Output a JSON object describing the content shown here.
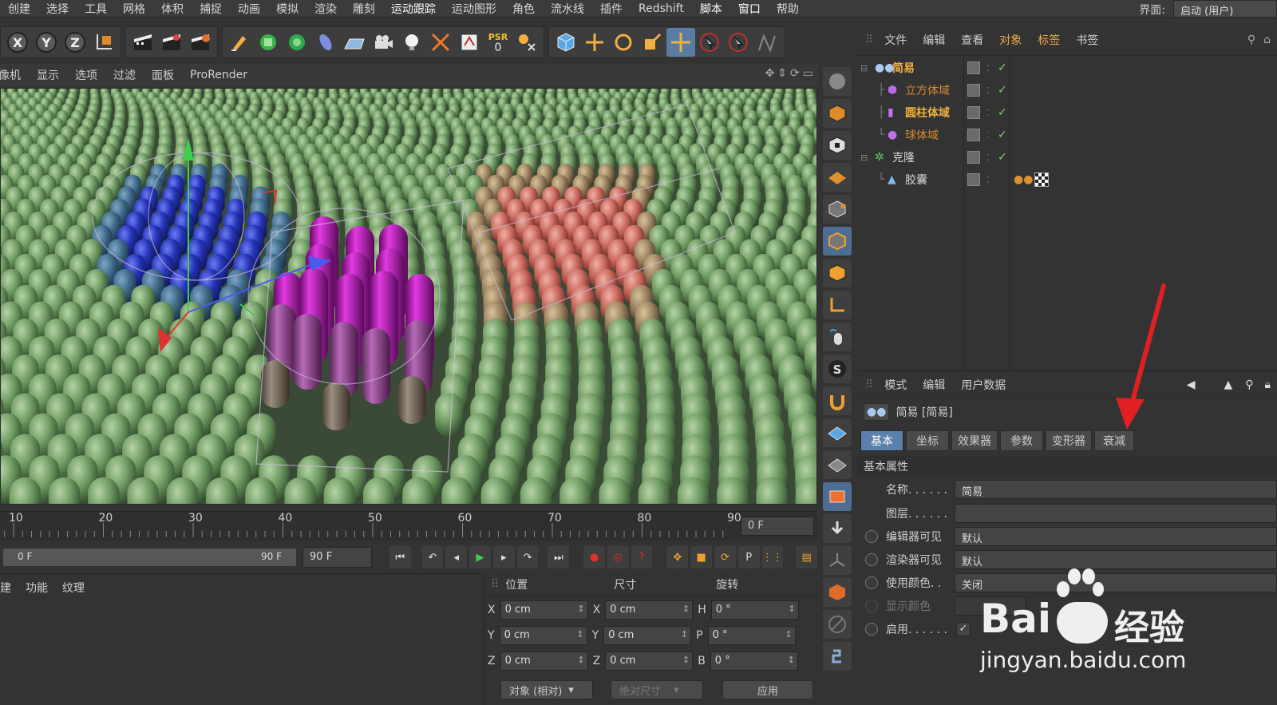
{
  "menu": [
    "创建",
    "选择",
    "工具",
    "网格",
    "体积",
    "捕捉",
    "动画",
    "模拟",
    "渲染",
    "雕刻",
    "运动跟踪",
    "运动图形",
    "角色",
    "流水线",
    "插件",
    "Redshift",
    "脚本",
    "窗口",
    "帮助"
  ],
  "layout_label": "界面:",
  "layout_value": "启动 (用户)",
  "toolbar": {
    "axis_x": "X",
    "axis_y": "Y",
    "axis_z": "Z",
    "psr_label": "PSR",
    "psr_value": "0"
  },
  "viewport_menu": [
    "摄像机",
    "显示",
    "选项",
    "过滤",
    "面板",
    "ProRender"
  ],
  "timeline": {
    "ticks": [
      "10",
      "20",
      "30",
      "40",
      "50",
      "60",
      "70",
      "80",
      "90"
    ],
    "current_frame": "0 F",
    "range_start": "0 F",
    "range_end": "90 F",
    "end_frame": "90 F"
  },
  "material_menu": [
    "创建",
    "功能",
    "纹理"
  ],
  "coordinates": {
    "headers": [
      "位置",
      "尺寸",
      "旋转"
    ],
    "rows": [
      {
        "pos_axis": "X",
        "pos": "0 cm",
        "size_axis": "X",
        "size": "0 cm",
        "rot_axis": "H",
        "rot": "0 °"
      },
      {
        "pos_axis": "Y",
        "pos": "0 cm",
        "size_axis": "Y",
        "size": "0 cm",
        "rot_axis": "P",
        "rot": "0 °"
      },
      {
        "pos_axis": "Z",
        "pos": "0 cm",
        "size_axis": "Z",
        "size": "0 cm",
        "rot_axis": "B",
        "rot": "0 °"
      }
    ],
    "mode": "对象 (相对)",
    "size_mode": "绝对尺寸",
    "apply": "应用"
  },
  "object_manager": {
    "menu": [
      "文件",
      "编辑",
      "查看",
      "对象",
      "标签",
      "书签"
    ],
    "objects": [
      {
        "name": "简易",
        "color": "#f0b040"
      },
      {
        "name": "立方体域",
        "color": "#d88a30"
      },
      {
        "name": "圆柱体域",
        "color": "#f0b040"
      },
      {
        "name": "球体域",
        "color": "#d88a30"
      },
      {
        "name": "克隆",
        "color": "#d8d8d8"
      },
      {
        "name": "胶囊",
        "color": "#d8d8d8"
      }
    ]
  },
  "attributes": {
    "menu": [
      "模式",
      "编辑",
      "用户数据"
    ],
    "title": "简易 [简易]",
    "tabs": [
      "基本",
      "坐标",
      "效果器",
      "参数",
      "变形器",
      "衰减"
    ],
    "section": "基本属性",
    "fields": [
      {
        "label": "名称. . . . . .",
        "value": "简易"
      },
      {
        "label": "图层. . . . . .",
        "value": ""
      },
      {
        "label": "编辑器可见",
        "value": "默认"
      },
      {
        "label": "渲染器可见",
        "value": "默认"
      },
      {
        "label": "使用颜色. .",
        "value": "关闭"
      },
      {
        "label": "显示颜色",
        "value": ""
      },
      {
        "label": "启用. . . . . .",
        "value": "✓"
      }
    ]
  },
  "watermark": {
    "brand": "Bai",
    "brand2": "经验",
    "url": "jingyan.baidu.com"
  },
  "colors": {
    "accent": "#f0a94a",
    "selected_tab": "#5b80ac",
    "arrow": "#e02020"
  }
}
